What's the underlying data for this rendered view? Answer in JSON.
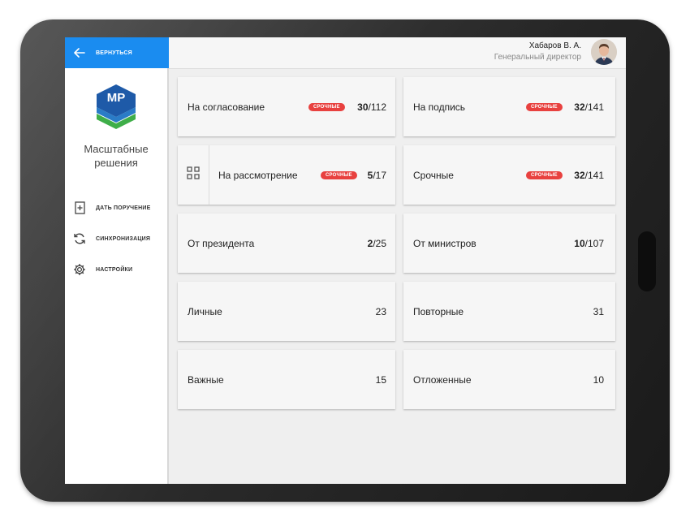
{
  "sidebar": {
    "back_label": "ВЕРНУТЬСЯ",
    "logo_text": "МР",
    "brand_line1": "Масштабные",
    "brand_line2": "решения",
    "menu": [
      {
        "label": "ДАТЬ ПОРУЧЕНИЕ",
        "icon": "add-document-icon"
      },
      {
        "label": "СИНХРОНИЗАЦИЯ",
        "icon": "sync-icon"
      },
      {
        "label": "НАСТРОЙКИ",
        "icon": "gear-icon"
      }
    ]
  },
  "header": {
    "user_name": "Хабаров В. А.",
    "user_role": "Генеральный директор"
  },
  "colors": {
    "accent": "#1a8cf0",
    "badge": "#e8413f",
    "logo_blue": "#1e5aa8",
    "logo_green": "#3fae49"
  },
  "cards": {
    "approval": {
      "label": "На согласование",
      "badge": "СРОЧНЫЕ",
      "bold": "30",
      "total": "/112"
    },
    "signature": {
      "label": "На подпись",
      "badge": "СРОЧНЫЕ",
      "bold": "32",
      "total": "/141"
    },
    "review": {
      "label": "На рассмотрение",
      "badge": "СРОЧНЫЕ",
      "bold": "5",
      "total": "/17"
    },
    "urgent": {
      "label": "Срочные",
      "badge": "СРОЧНЫЕ",
      "bold": "32",
      "total": "/141"
    },
    "president": {
      "label": "От президента",
      "bold": "2",
      "total": "/25"
    },
    "ministers": {
      "label": "От министров",
      "bold": "10",
      "total": "/107"
    },
    "personal": {
      "label": "Личные",
      "count": "23"
    },
    "repeated": {
      "label": "Повторные",
      "count": "31"
    },
    "important": {
      "label": "Важные",
      "count": "15"
    },
    "postponed": {
      "label": "Отложенные",
      "count": "10"
    }
  }
}
